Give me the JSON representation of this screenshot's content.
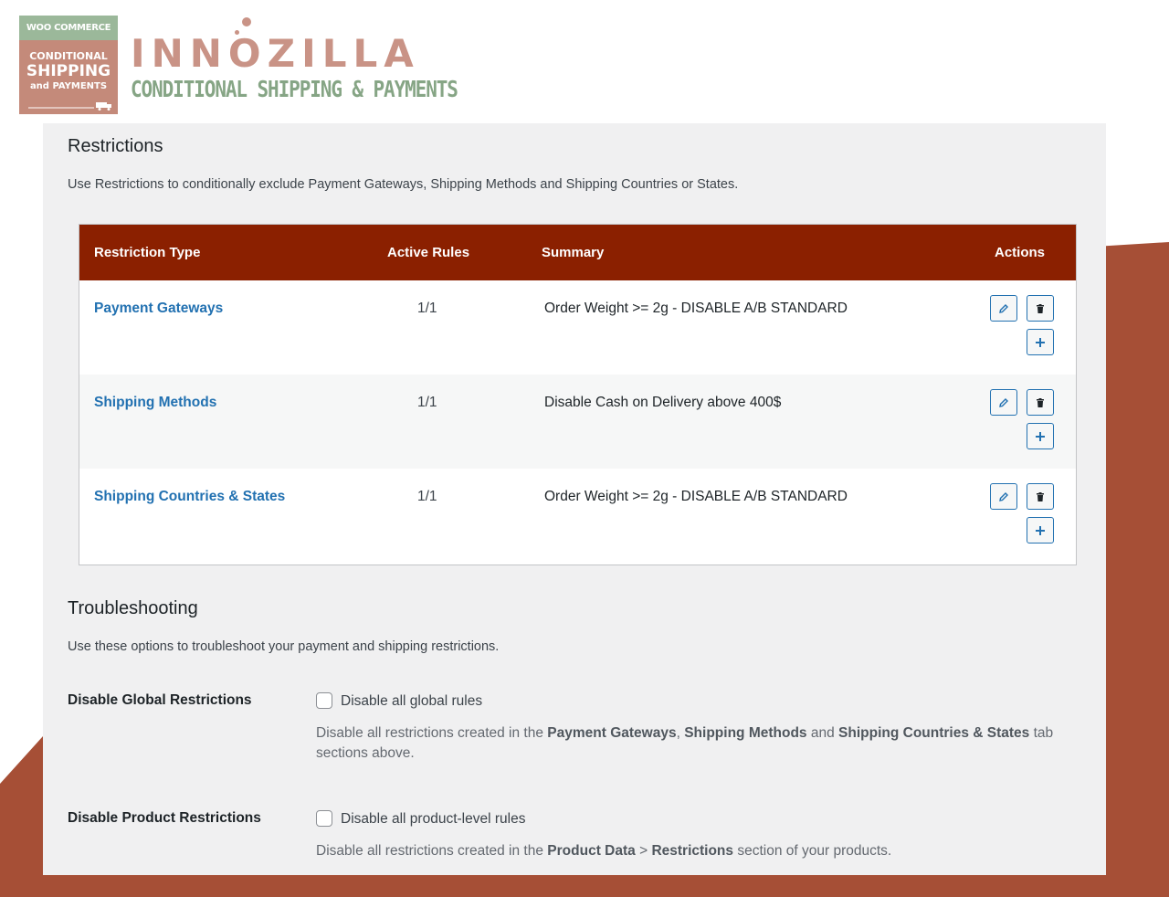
{
  "logo": {
    "badge_top": "WOO COMMERCE",
    "badge_line1": "CONDITIONAL",
    "badge_line2": "SHIPPING",
    "badge_line3": "and PAYMENTS",
    "brand_name": "INNOZILLA",
    "brand_tagline": "CONDITIONAL SHIPPING & PAYMENTS"
  },
  "restrictions": {
    "title": "Restrictions",
    "description": "Use Restrictions to conditionally exclude Payment Gateways, Shipping Methods and Shipping Countries or States.",
    "columns": {
      "type": "Restriction Type",
      "rules": "Active Rules",
      "summary": "Summary",
      "actions": "Actions"
    },
    "rows": [
      {
        "type": "Payment Gateways",
        "rules": "1/1",
        "summary": "Order Weight >= 2g - DISABLE A/B STANDARD"
      },
      {
        "type": "Shipping Methods",
        "rules": "1/1",
        "summary": "Disable Cash on Delivery above 400$"
      },
      {
        "type": "Shipping Countries & States",
        "rules": "1/1",
        "summary": "Order Weight >= 2g - DISABLE A/B STANDARD"
      }
    ],
    "action_icons": [
      "edit-icon",
      "trash-icon",
      "plus-icon"
    ]
  },
  "troubleshooting": {
    "title": "Troubleshooting",
    "description": "Use these options to troubleshoot your payment and shipping restrictions.",
    "global": {
      "label": "Disable Global Restrictions",
      "checkbox_label": "Disable all global rules",
      "checked": false,
      "desc_prefix": "Disable all restrictions created in the ",
      "desc_b1": "Payment Gateways",
      "desc_sep1": ", ",
      "desc_b2": "Shipping Methods",
      "desc_sep2": " and ",
      "desc_b3": "Shipping Countries & States",
      "desc_suffix": " tab sections above."
    },
    "product": {
      "label": "Disable Product Restrictions",
      "checkbox_label": "Disable all product-level rules",
      "checked": false,
      "desc_prefix": "Disable all restrictions created in the ",
      "desc_b1": "Product Data",
      "desc_sep1": " > ",
      "desc_b2": "Restrictions",
      "desc_suffix": " section of your products."
    }
  },
  "colors": {
    "header_bg": "#8b2000",
    "link": "#2271b1",
    "brand": "#c99386",
    "accent_bg": "#a64f36"
  }
}
